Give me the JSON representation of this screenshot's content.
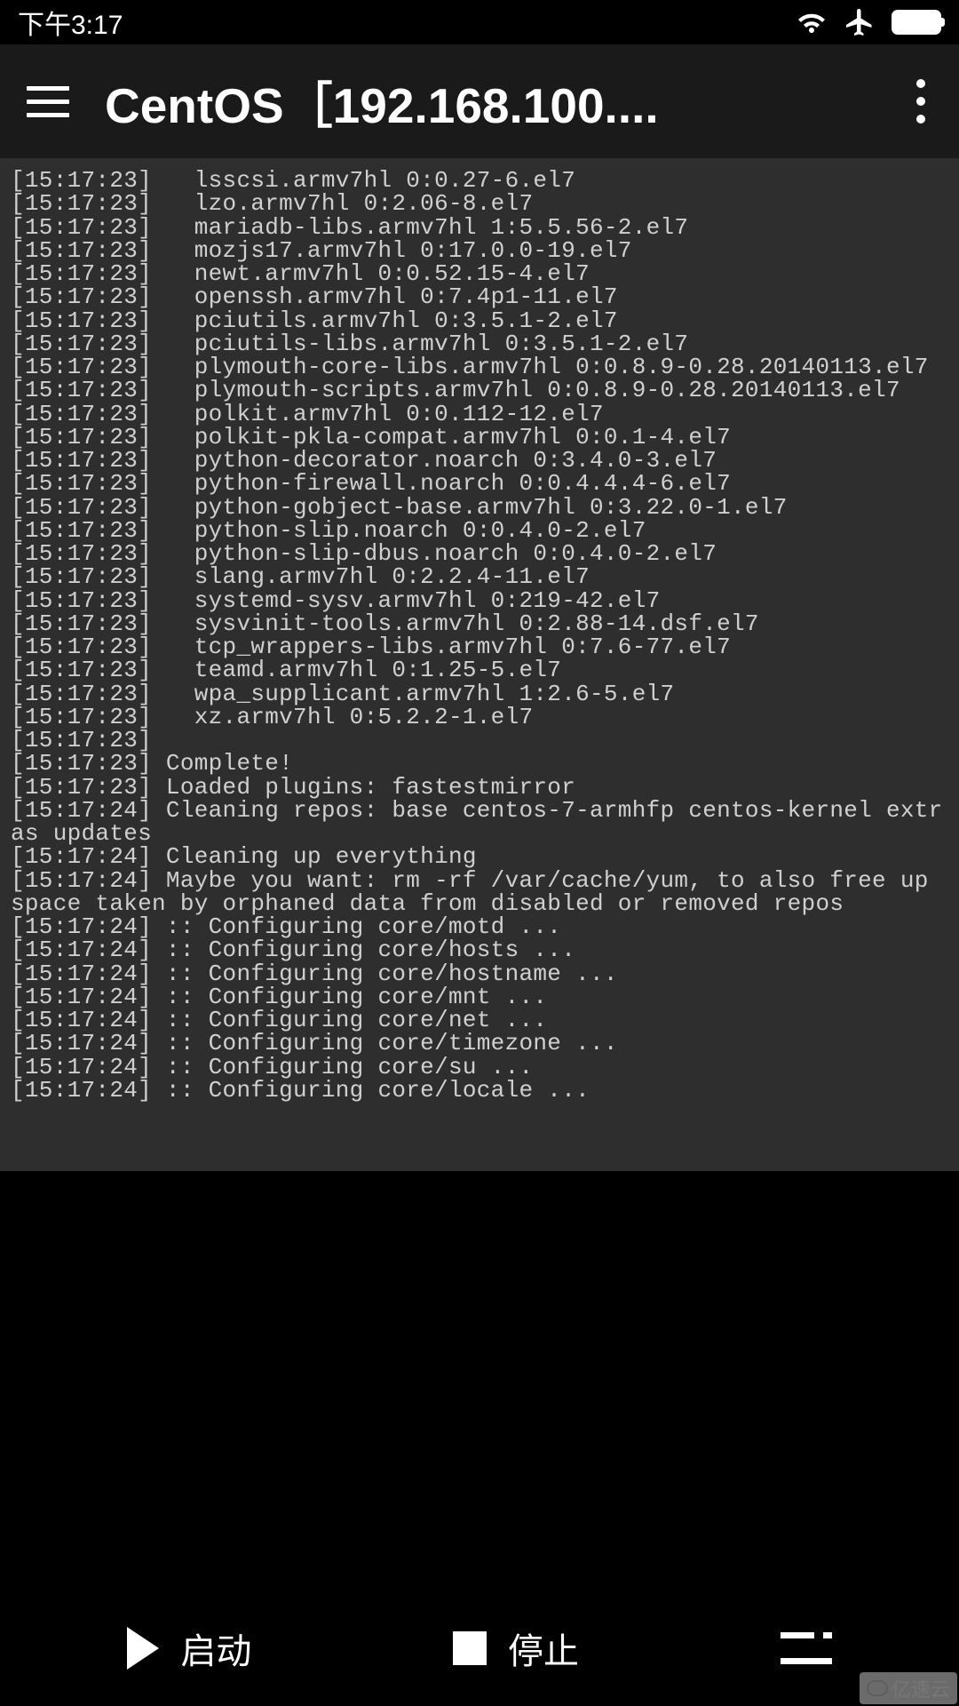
{
  "status_bar": {
    "time": "下午3:17"
  },
  "app_bar": {
    "title": "CentOS［192.168.100...."
  },
  "terminal": {
    "lines": [
      "[15:17:23]   lsscsi.armv7hl 0:0.27-6.el7",
      "[15:17:23]   lzo.armv7hl 0:2.06-8.el7",
      "[15:17:23]   mariadb-libs.armv7hl 1:5.5.56-2.el7",
      "[15:17:23]   mozjs17.armv7hl 0:17.0.0-19.el7",
      "[15:17:23]   newt.armv7hl 0:0.52.15-4.el7",
      "[15:17:23]   openssh.armv7hl 0:7.4p1-11.el7",
      "[15:17:23]   pciutils.armv7hl 0:3.5.1-2.el7",
      "[15:17:23]   pciutils-libs.armv7hl 0:3.5.1-2.el7",
      "[15:17:23]   plymouth-core-libs.armv7hl 0:0.8.9-0.28.20140113.el7",
      "[15:17:23]   plymouth-scripts.armv7hl 0:0.8.9-0.28.20140113.el7",
      "[15:17:23]   polkit.armv7hl 0:0.112-12.el7",
      "[15:17:23]   polkit-pkla-compat.armv7hl 0:0.1-4.el7",
      "[15:17:23]   python-decorator.noarch 0:3.4.0-3.el7",
      "[15:17:23]   python-firewall.noarch 0:0.4.4.4-6.el7",
      "[15:17:23]   python-gobject-base.armv7hl 0:3.22.0-1.el7",
      "[15:17:23]   python-slip.noarch 0:0.4.0-2.el7",
      "[15:17:23]   python-slip-dbus.noarch 0:0.4.0-2.el7",
      "[15:17:23]   slang.armv7hl 0:2.2.4-11.el7",
      "[15:17:23]   systemd-sysv.armv7hl 0:219-42.el7",
      "[15:17:23]   sysvinit-tools.armv7hl 0:2.88-14.dsf.el7",
      "[15:17:23]   tcp_wrappers-libs.armv7hl 0:7.6-77.el7",
      "[15:17:23]   teamd.armv7hl 0:1.25-5.el7",
      "[15:17:23]   wpa_supplicant.armv7hl 1:2.6-5.el7",
      "[15:17:23]   xz.armv7hl 0:5.2.2-1.el7",
      "[15:17:23]",
      "[15:17:23] Complete!",
      "[15:17:23] Loaded plugins: fastestmirror",
      "[15:17:24] Cleaning repos: base centos-7-armhfp centos-kernel extras updates",
      "[15:17:24] Cleaning up everything",
      "[15:17:24] Maybe you want: rm -rf /var/cache/yum, to also free up space taken by orphaned data from disabled or removed repos",
      "[15:17:24] :: Configuring core/motd ...",
      "[15:17:24] :: Configuring core/hosts ...",
      "[15:17:24] :: Configuring core/hostname ...",
      "[15:17:24] :: Configuring core/mnt ...",
      "[15:17:24] :: Configuring core/net ...",
      "[15:17:24] :: Configuring core/timezone ...",
      "[15:17:24] :: Configuring core/su ...",
      "[15:17:24] :: Configuring core/locale ..."
    ]
  },
  "bottom_bar": {
    "start_label": "启动",
    "stop_label": "停止"
  },
  "watermark": {
    "text": "亿速云"
  }
}
